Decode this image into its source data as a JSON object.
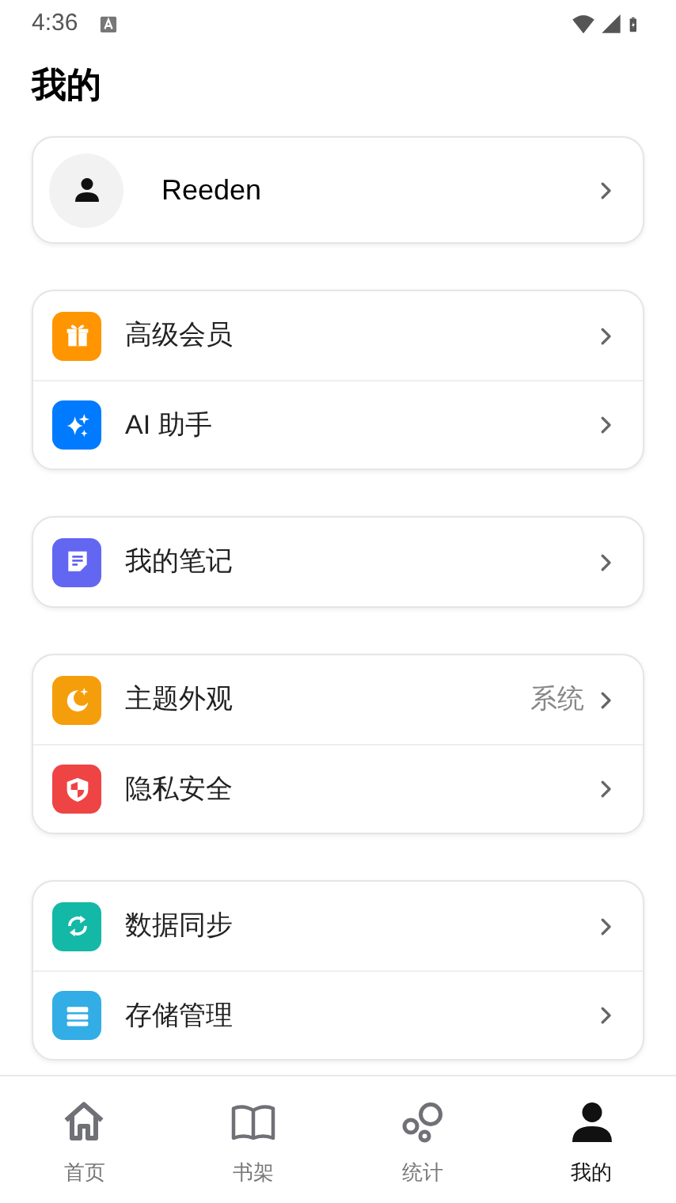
{
  "status_bar": {
    "time": "4:36"
  },
  "title": "我的",
  "profile": {
    "name": "Reeden"
  },
  "groups": [
    {
      "items": [
        {
          "label": "高级会员",
          "color": "#ff9500"
        },
        {
          "label": "AI 助手",
          "color": "#007aff"
        }
      ]
    },
    {
      "items": [
        {
          "label": "我的笔记",
          "color": "#6366f1"
        }
      ]
    },
    {
      "items": [
        {
          "label": "主题外观",
          "color": "#f59e0b",
          "value": "系统"
        },
        {
          "label": "隐私安全",
          "color": "#ef4444"
        }
      ]
    },
    {
      "items": [
        {
          "label": "数据同步",
          "color": "#14b8a6"
        },
        {
          "label": "存储管理",
          "color": "#32ade6"
        }
      ]
    }
  ],
  "tabs": [
    {
      "label": "首页",
      "selected": false
    },
    {
      "label": "书架",
      "selected": false
    },
    {
      "label": "统计",
      "selected": false
    },
    {
      "label": "我的",
      "selected": true
    }
  ]
}
